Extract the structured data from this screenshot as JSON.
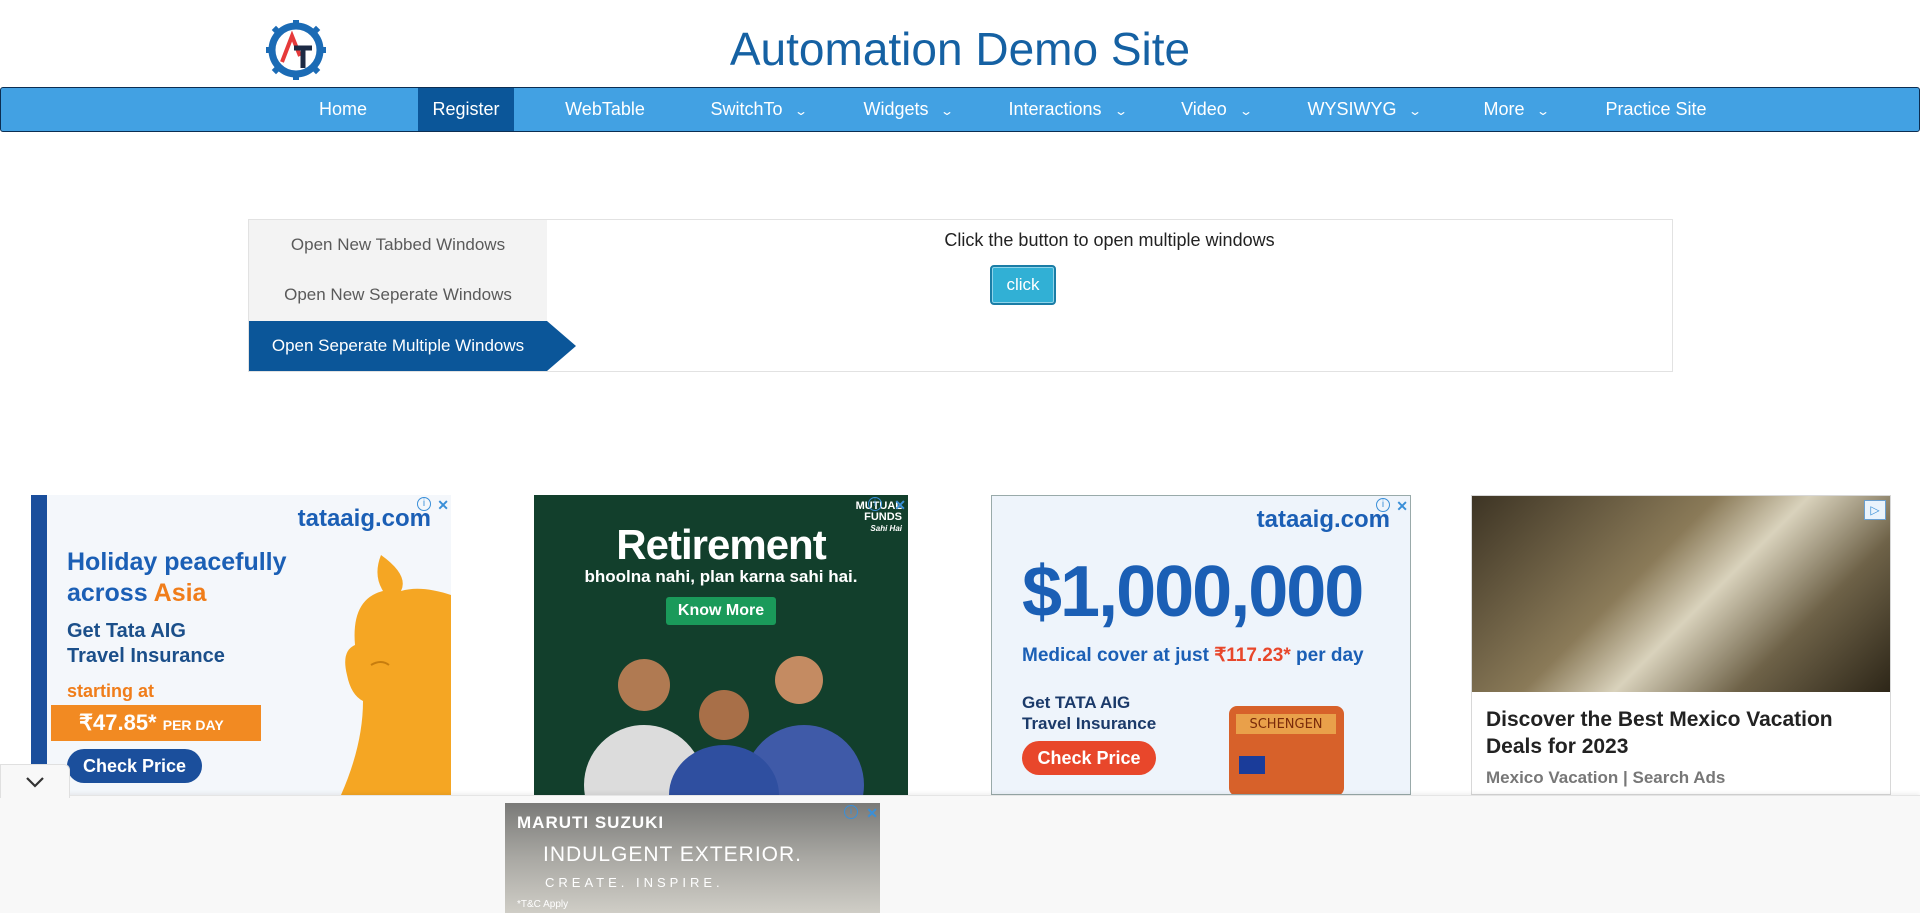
{
  "header": {
    "title": "Automation Demo Site"
  },
  "nav": {
    "items": [
      {
        "label": "Home",
        "dropdown": false,
        "active": false
      },
      {
        "label": "Register",
        "dropdown": false,
        "active": true
      },
      {
        "label": "WebTable",
        "dropdown": false,
        "active": false
      },
      {
        "label": "SwitchTo",
        "dropdown": true,
        "active": false
      },
      {
        "label": "Widgets",
        "dropdown": true,
        "active": false
      },
      {
        "label": "Interactions",
        "dropdown": true,
        "active": false
      },
      {
        "label": "Video",
        "dropdown": true,
        "active": false
      },
      {
        "label": "WYSIWYG",
        "dropdown": true,
        "active": false
      },
      {
        "label": "More",
        "dropdown": true,
        "active": false
      },
      {
        "label": "Practice Site",
        "dropdown": false,
        "active": false
      }
    ]
  },
  "windows": {
    "tabs": [
      {
        "label": "Open New Tabbed Windows",
        "active": false
      },
      {
        "label": "Open New Seperate Windows",
        "active": false
      },
      {
        "label": "Open Seperate Multiple Windows",
        "active": true
      }
    ],
    "instruction": "Click the button to open multiple windows",
    "button_label": "click"
  },
  "ads": {
    "tata_asia": {
      "brand": "tataaig.com",
      "line1": "Holiday peacefully",
      "line2a": "across ",
      "line2b": "Asia",
      "line3": "Get Tata AIG",
      "line4": "Travel Insurance",
      "starting": "starting at",
      "price": "₹47.85*",
      "per_day": "PER DAY",
      "cta": "Check Price"
    },
    "retirement": {
      "mf1": "MUTUAL",
      "mf2": "FUNDS",
      "mf3": "Sahi Hai",
      "title": "Retirement",
      "sub": "bhoolna nahi, plan karna sahi hai.",
      "cta": "Know More"
    },
    "tata_million": {
      "brand": "tataaig.com",
      "big": "$1,000,000",
      "medical_a": "Medical cover at just ",
      "medical_b": "₹117.23*",
      "medical_c": " per day",
      "get1": "Get TATA AIG",
      "get2": "Travel Insurance",
      "case_label": "SCHENGEN",
      "cta": "Check Price"
    },
    "mexico": {
      "headline": "Discover the Best Mexico Vacation Deals for 2023",
      "source": "Mexico Vacation | Search Ads"
    },
    "maruti": {
      "brand": "MARUTI SUZUKI",
      "t1": "INDULGENT EXTERIOR.",
      "t2": "CREATE. INSPIRE.",
      "t3": "*T&C Apply"
    }
  },
  "colors": {
    "nav_bg": "#42a1e3",
    "nav_active": "#0b5699",
    "title": "#1561a3",
    "button": "#31b0d5"
  }
}
